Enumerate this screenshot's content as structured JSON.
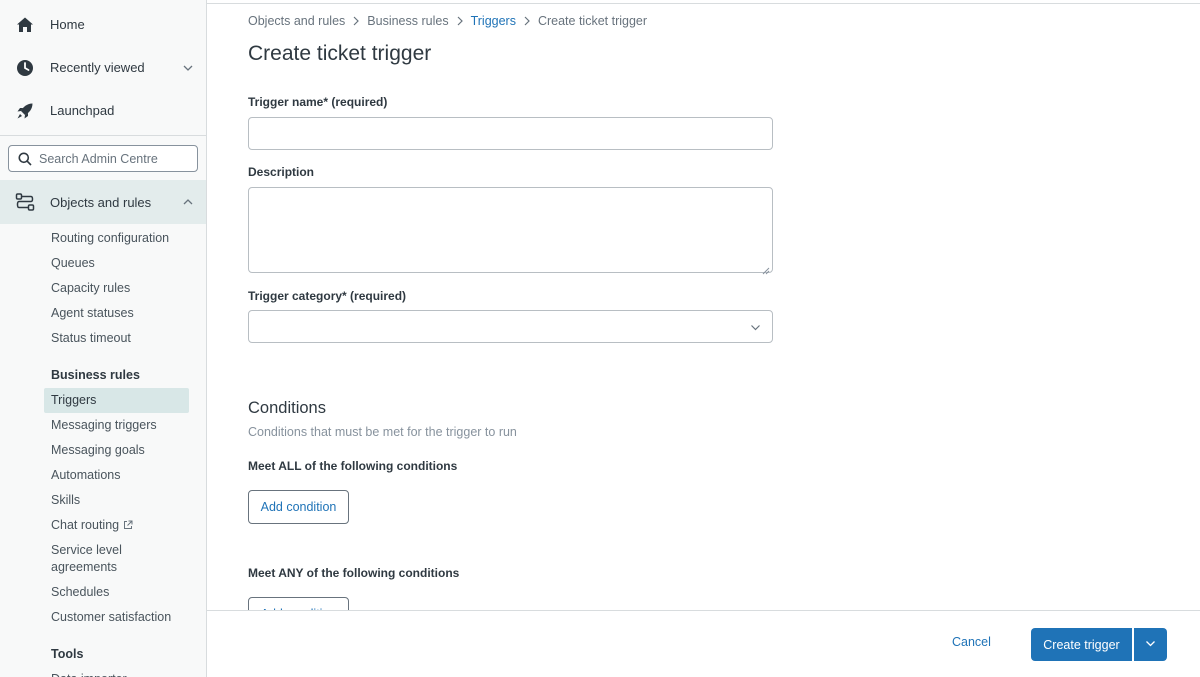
{
  "sidebar": {
    "home": "Home",
    "recently_viewed": "Recently viewed",
    "launchpad": "Launchpad",
    "search_placeholder": "Search Admin Centre",
    "objects_and_rules": "Objects and rules",
    "routing_items": [
      "Routing configuration",
      "Queues",
      "Capacity rules",
      "Agent statuses",
      "Status timeout"
    ],
    "business_rules_heading": "Business rules",
    "business_items": [
      "Triggers",
      "Messaging triggers",
      "Messaging goals",
      "Automations",
      "Skills",
      "Chat routing",
      "Service level agreements",
      "Schedules",
      "Customer satisfaction"
    ],
    "tools_heading": "Tools",
    "tools_items": [
      "Data importer"
    ]
  },
  "breadcrumb": [
    "Objects and rules",
    "Business rules",
    "Triggers",
    "Create ticket trigger"
  ],
  "page_title": "Create ticket trigger",
  "form": {
    "trigger_name_label": "Trigger name* (required)",
    "trigger_name_value": "",
    "description_label": "Description",
    "description_value": "",
    "category_label": "Trigger category* (required)",
    "category_value": ""
  },
  "conditions": {
    "title": "Conditions",
    "hint": "Conditions that must be met for the trigger to run",
    "all_label": "Meet ALL of the following conditions",
    "any_label": "Meet ANY of the following conditions",
    "add_condition": "Add condition"
  },
  "footer": {
    "cancel": "Cancel",
    "create": "Create trigger"
  },
  "colors": {
    "accent": "#1f73b7",
    "sidebar_active": "#d8e7e7"
  }
}
